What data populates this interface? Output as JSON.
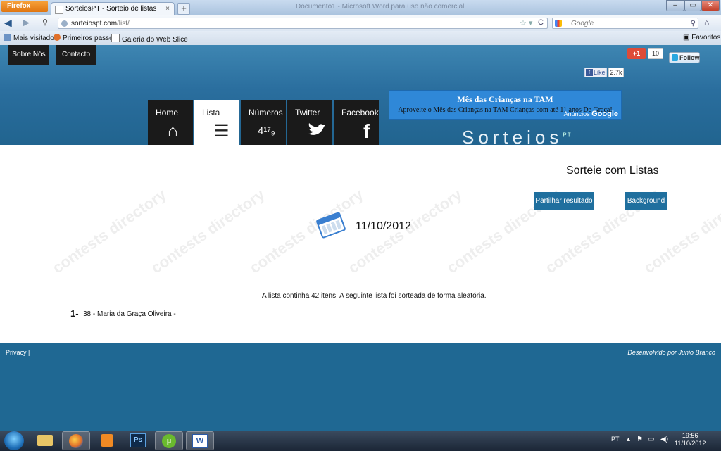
{
  "browser": {
    "menu_button": "Firefox",
    "tab_title": "SorteiosPT - Sorteio de listas",
    "tab_close": "×",
    "new_tab": "+",
    "window_title": "Documento1 - Microsoft Word para uso não comercial",
    "url_host": "sorteiospt.com",
    "url_path": "/list/",
    "search_placeholder": "Google",
    "bookmarks": [
      "Mais visitados",
      "Primeiros passos",
      "Galeria do Web Slice"
    ],
    "favorites_label": "Favoritos"
  },
  "topnav": {
    "about": "Sobre Nós",
    "contact": "Contacto"
  },
  "tabs": [
    {
      "label": "Home",
      "icon": "home-icon",
      "glyph": "⌂"
    },
    {
      "label": "Lista",
      "icon": "list-icon",
      "glyph": "☰"
    },
    {
      "label": "Números",
      "icon": "numbers-icon",
      "glyph": "4¹⁷₉"
    },
    {
      "label": "Twitter",
      "icon": "twitter-bird-icon",
      "glyph": "🐦"
    },
    {
      "label": "Facebook",
      "icon": "facebook-icon",
      "glyph": "f"
    }
  ],
  "ad": {
    "title": "Mês das Crianças na TAM",
    "text": "Aproveite o Mês das Crianças na TAM Crianças com até 11 anos De Graça!",
    "label": "Anúncios",
    "brand": "Google"
  },
  "logo": {
    "text": "Sorteios",
    "suffix": "PT"
  },
  "social": {
    "gplus_label": "+1",
    "gplus_count": "10",
    "twitter_follow": "Follow",
    "fb_like": "Like",
    "fb_count": "2.7k"
  },
  "main": {
    "heading": "Sorteie com Listas",
    "share_button": "Partilhar resultado",
    "background_button": "Background",
    "date": "11/10/2012",
    "summary": "A lista continha 42 itens. A seguinte lista foi sorteada de forma aleatória.",
    "results": [
      {
        "rank": "1-",
        "text": "38 - Maria da Graça Oliveira -"
      }
    ],
    "watermark": "contests directory"
  },
  "footer": {
    "privacy": "Privacy |",
    "credit": "Desenvolvido por Junio Branco"
  },
  "taskbar": {
    "apps": [
      "explorer",
      "firefox",
      "media",
      "Ps",
      "µ",
      "W"
    ],
    "language": "PT",
    "time": "19:56",
    "date": "11/10/2012"
  },
  "colors": {
    "banner": "#2a6e9e",
    "footer": "#1f6893",
    "button_blue": "#1f6f9e",
    "nav_tile": "#1a1a1a"
  }
}
